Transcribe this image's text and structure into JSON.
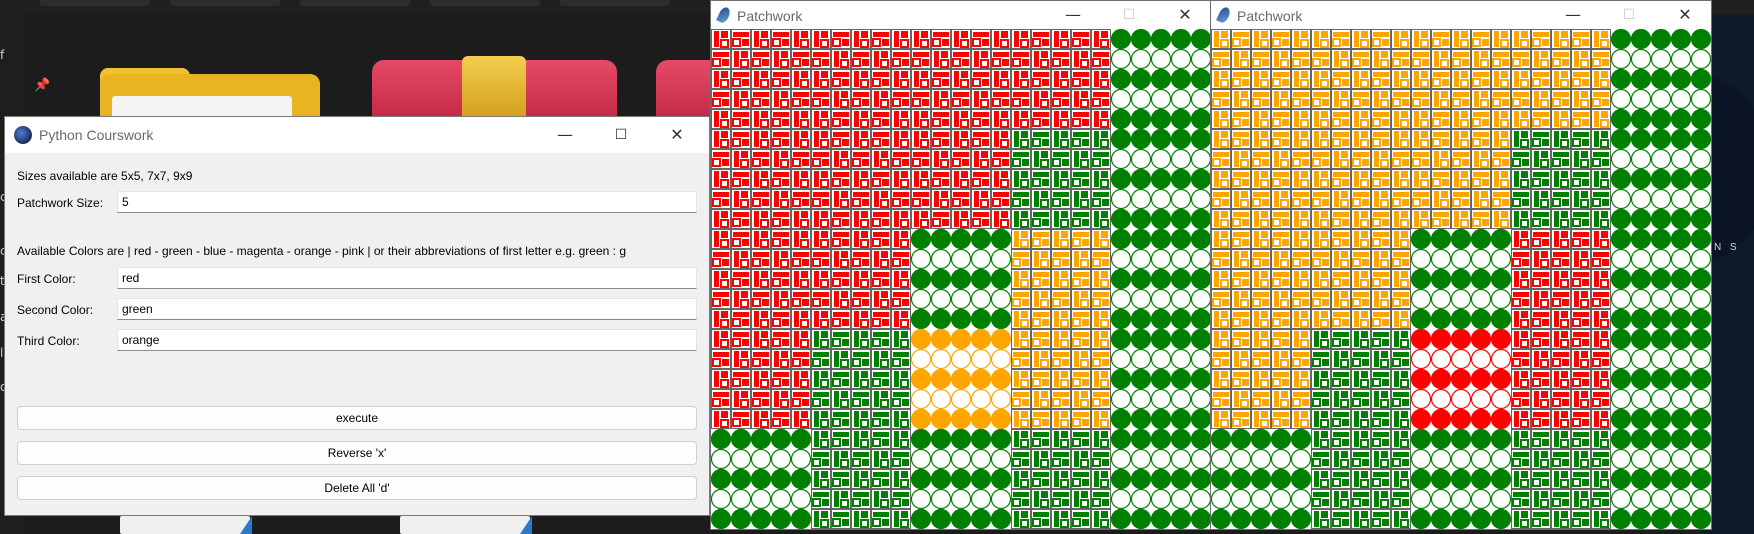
{
  "desktop": {
    "top_tabs": [
      "",
      "",
      "",
      "",
      ""
    ],
    "side_glyphs": [
      "f",
      "c",
      "c",
      "t",
      "a",
      "l",
      "d"
    ],
    "badge_text": "N S"
  },
  "python_window": {
    "title": "Python Courswork",
    "controls": {
      "minimize": "—",
      "maximize": "☐",
      "close": "✕"
    },
    "sizes_text": "Sizes available are 5x5, 7x7, 9x9",
    "size_label": "Patchwork Size:",
    "size_value": "5",
    "colors_text": "Available Colors are | red - green - blue - magenta - orange - pink |  or their abbreviations of first letter e.g. green : g",
    "first_label": "First Color:",
    "first_value": "red",
    "second_label": "Second Color:",
    "second_value": "green",
    "third_label": "Third Color:",
    "third_value": "orange",
    "execute_label": "execute",
    "reverse_label": "Reverse 'x'",
    "delete_label": "Delete All 'd'"
  },
  "patchwork_windows": [
    {
      "title": "Patchwork",
      "controls": {
        "minimize": "—",
        "maximize": "☐",
        "close": "✕"
      },
      "grid": [
        [
          "R",
          "R",
          "R",
          "R",
          "G"
        ],
        [
          "R",
          "R",
          "R",
          "G",
          "G"
        ],
        [
          "R",
          "R",
          "G",
          "O",
          "G"
        ],
        [
          "R",
          "G",
          "O",
          "O",
          "G"
        ],
        [
          "G",
          "G",
          "G",
          "G",
          "G"
        ]
      ],
      "patterns": [
        [
          "A",
          "A",
          "A",
          "A",
          "P"
        ],
        [
          "A",
          "A",
          "A",
          "A",
          "P"
        ],
        [
          "A",
          "A",
          "P",
          "A",
          "P"
        ],
        [
          "A",
          "A",
          "P",
          "A",
          "P"
        ],
        [
          "P",
          "A",
          "P",
          "A",
          "P"
        ]
      ]
    },
    {
      "title": "Patchwork",
      "controls": {
        "minimize": "—",
        "maximize": "☐",
        "close": "✕"
      },
      "grid": [
        [
          "O",
          "O",
          "O",
          "O",
          "G"
        ],
        [
          "O",
          "O",
          "O",
          "G",
          "G"
        ],
        [
          "O",
          "O",
          "G",
          "R",
          "G"
        ],
        [
          "O",
          "G",
          "R",
          "R",
          "G"
        ],
        [
          "G",
          "G",
          "G",
          "G",
          "G"
        ]
      ],
      "patterns": [
        [
          "A",
          "A",
          "A",
          "A",
          "P"
        ],
        [
          "A",
          "A",
          "A",
          "A",
          "P"
        ],
        [
          "A",
          "A",
          "P",
          "A",
          "P"
        ],
        [
          "A",
          "A",
          "P",
          "A",
          "P"
        ],
        [
          "P",
          "A",
          "P",
          "A",
          "P"
        ]
      ]
    }
  ],
  "colors": {
    "R": "#ff0000",
    "G": "#008000",
    "O": "#ffa500"
  }
}
